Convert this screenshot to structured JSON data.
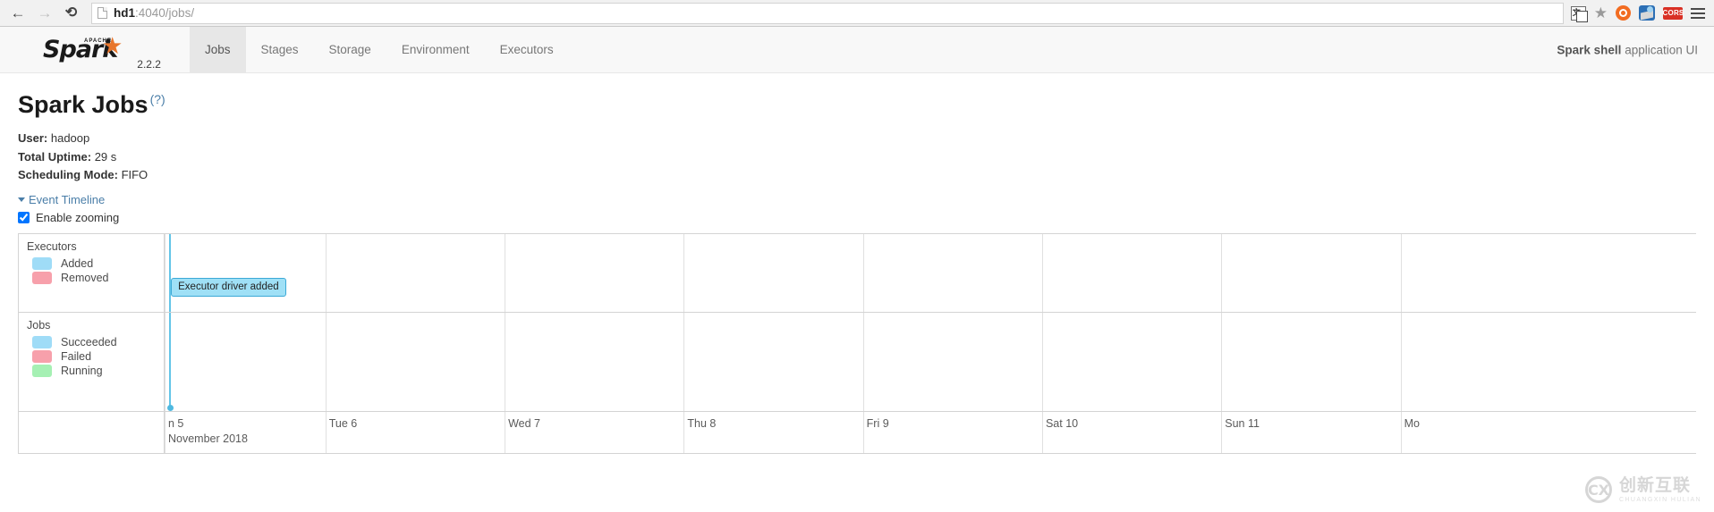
{
  "browser": {
    "back_label": "←",
    "forward_label": "→",
    "reload_label": "⟳",
    "url_prefix": "hd1",
    "url_suffix": ":4040/jobs/",
    "icons": {
      "page_icon": "page-icon",
      "translate_icon": "translate-icon",
      "translate_glyph": "文",
      "bookmark_icon": "★",
      "extension_orange_icon": "extension-orange-icon",
      "extension_blue_icon": "extension-blue-icon",
      "cors_badge_label": "CORS",
      "menu_icon": "hamburger-menu-icon"
    }
  },
  "navbar": {
    "brand_apache": "APACHE",
    "brand_name": "Spark",
    "brand_star": "★",
    "version": "2.2.2",
    "items": [
      {
        "label": "Jobs",
        "active": true
      },
      {
        "label": "Stages",
        "active": false
      },
      {
        "label": "Storage",
        "active": false
      },
      {
        "label": "Environment",
        "active": false
      },
      {
        "label": "Executors",
        "active": false
      }
    ],
    "app_name": "Spark shell",
    "app_suffix": " application UI"
  },
  "page": {
    "title": "Spark Jobs",
    "title_help": "(?)",
    "user_label": "User:",
    "user_value": " hadoop",
    "uptime_label": "Total Uptime:",
    "uptime_value": " 29 s",
    "scheduling_label": "Scheduling Mode:",
    "scheduling_value": " FIFO",
    "event_timeline_label": "Event Timeline",
    "enable_zooming_label": "Enable zooming"
  },
  "timeline": {
    "executors_group": "Executors",
    "jobs_group": "Jobs",
    "legend": {
      "executors": [
        {
          "label": "Added",
          "color": "#9fdcf7"
        },
        {
          "label": "Removed",
          "color": "#f7a0ab"
        }
      ],
      "jobs": [
        {
          "label": "Succeeded",
          "color": "#9fdcf7"
        },
        {
          "label": "Failed",
          "color": "#f7a0ab"
        },
        {
          "label": "Running",
          "color": "#a5f0b3"
        }
      ]
    },
    "events": [
      {
        "label": "Executor driver added",
        "left_pct": 0.3
      }
    ],
    "axis_labels": [
      {
        "label": "n 5",
        "sub": "November 2018",
        "left_pct": 0.0
      },
      {
        "label": "Tue 6",
        "sub": "",
        "left_pct": 10.5
      },
      {
        "label": "Wed 7",
        "sub": "",
        "left_pct": 22.2
      },
      {
        "label": "Thu 8",
        "sub": "",
        "left_pct": 33.9
      },
      {
        "label": "Fri 9",
        "sub": "",
        "left_pct": 45.6
      },
      {
        "label": "Sat 10",
        "sub": "",
        "left_pct": 57.3
      },
      {
        "label": "Sun 11",
        "sub": "",
        "left_pct": 69.0
      },
      {
        "label": "Mo",
        "sub": "",
        "left_pct": 80.7
      }
    ],
    "gridline_pcts": [
      0.0,
      10.5,
      22.2,
      33.9,
      45.6,
      57.3,
      69.0,
      80.7
    ]
  },
  "watermark": {
    "mark": "CX",
    "chinese": "创新互联",
    "english": "CHUANGXIN HULIAN"
  }
}
